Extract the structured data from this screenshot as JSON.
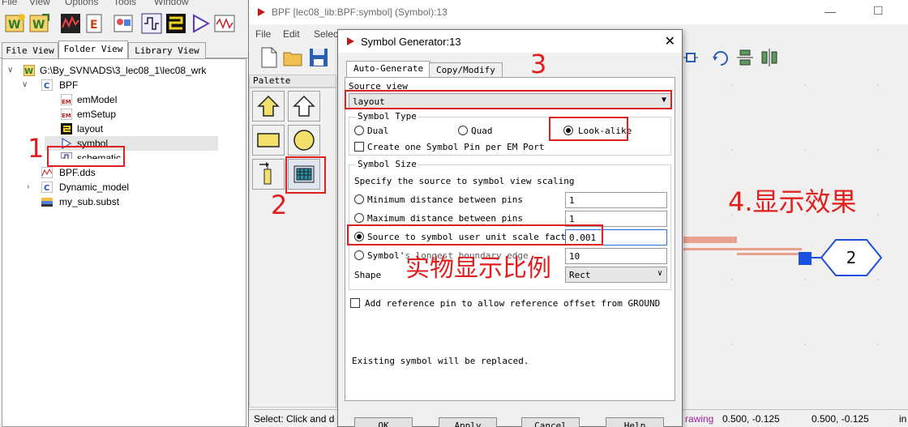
{
  "main_window": {
    "menu": [
      "File",
      "View",
      "Options",
      "Tools",
      "Window"
    ],
    "tabs": [
      "File View",
      "Folder View",
      "Library View"
    ],
    "active_tab": "Folder View",
    "tree": {
      "root": "G:\\By_SVN\\ADS\\3_lec08_1\\lec08_wrk",
      "cell": "BPF",
      "views": [
        "emModel",
        "emSetup",
        "layout",
        "symbol",
        "schematic"
      ],
      "selected_view": "symbol",
      "siblings": [
        "BPF.dds",
        "Dynamic_model",
        "my_sub.subst"
      ]
    }
  },
  "schematic_window": {
    "title": "BPF [lec08_lib:BPF:symbol] (Symbol):13",
    "menu": [
      "File",
      "Edit",
      "Select"
    ],
    "palette_label": "Palette",
    "status": {
      "left": "Select: Click and d",
      "mode": "rawing",
      "coord1": "0.500, -0.125",
      "coord2": "0.500, -0.125",
      "unit": "in"
    },
    "port_number": "2"
  },
  "dialog": {
    "title": "Symbol Generator:13",
    "tabs": [
      "Auto-Generate",
      "Copy/Modify"
    ],
    "active_tab": "Auto-Generate",
    "source_view_label": "Source view",
    "source_view_value": "layout",
    "symbol_type": {
      "title": "Symbol Type",
      "options": [
        "Dual",
        "Quad",
        "Look-alike"
      ],
      "selected": "Look-alike",
      "checkbox_label": "Create one Symbol Pin per EM Port"
    },
    "symbol_size": {
      "title": "Symbol Size",
      "description": "Specify the source to symbol view scaling",
      "options": [
        {
          "label": "Minimum distance between pins",
          "value": "1"
        },
        {
          "label": "Maximum distance between pins",
          "value": "1"
        },
        {
          "label": "Source to symbol user unit scale factor",
          "value": "0.001"
        },
        {
          "label": "Symbol's longest boundary edge",
          "value": "10"
        }
      ],
      "selected_index": 2,
      "shape_label": "Shape",
      "shape_value": "Rect"
    },
    "ref_pin_label": "Add reference pin to allow reference offset from GROUND",
    "footer_note": "Existing symbol will be replaced.",
    "buttons": [
      "OK",
      "Apply",
      "Cancel",
      "Help"
    ]
  },
  "annotations": {
    "step1": "1",
    "step2": "2",
    "step3": "3",
    "step4": "4.显示效果",
    "scale_note": "实物显示比例"
  },
  "colors": {
    "annotation_red": "#e02020",
    "pin_blue": "#1a4fe0",
    "wire_pink": "#e8a090",
    "selection_gray": "#e5e5e5"
  }
}
